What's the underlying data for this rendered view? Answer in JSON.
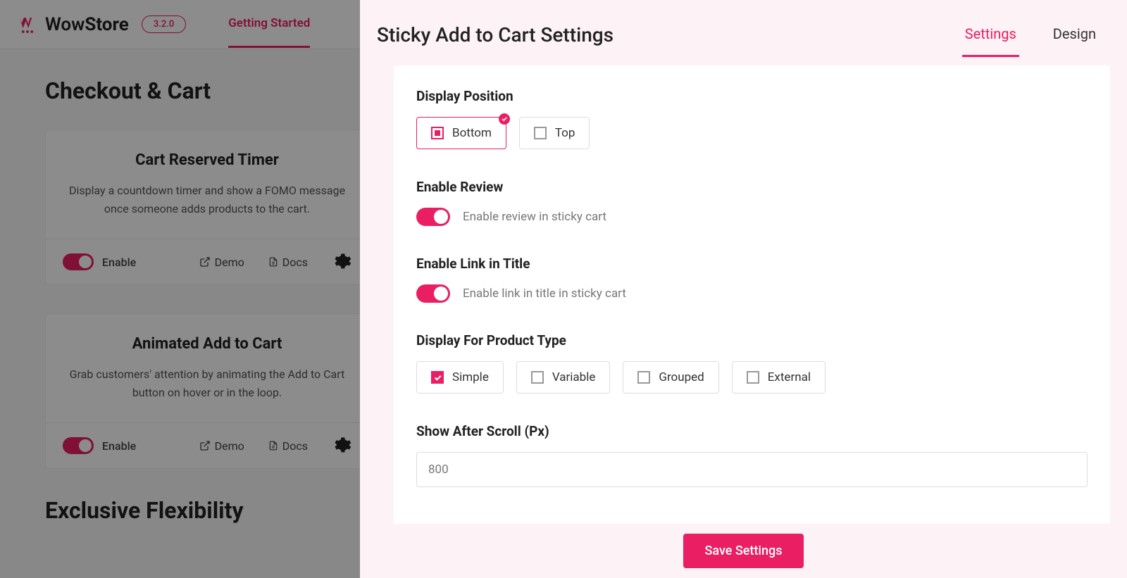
{
  "header": {
    "logo": "WowStore",
    "logo_part1": "Wow",
    "logo_part2": "Store",
    "version": "3.2.0",
    "nav": {
      "getting_started": "Getting Started"
    }
  },
  "page": {
    "section_title": "Checkout & Cart",
    "section2_title": "Exclusive Flexibility",
    "cards": [
      {
        "title": "Cart Reserved Timer",
        "desc": "Display a countdown timer and show a FOMO message once someone adds products to the cart.",
        "enable": "Enable",
        "demo": "Demo",
        "docs": "Docs"
      },
      {
        "title": "Animated Add to Cart",
        "desc": "Grab customers' attention by animating the Add to Cart button on hover or in the loop.",
        "enable": "Enable",
        "demo": "Demo",
        "docs": "Docs"
      }
    ]
  },
  "panel": {
    "title": "Sticky Add to Cart Settings",
    "tabs": {
      "settings": "Settings",
      "design": "Design"
    },
    "settings": {
      "display_position": {
        "label": "Display Position",
        "options": {
          "bottom": "Bottom",
          "top": "Top"
        }
      },
      "enable_review": {
        "label": "Enable Review",
        "desc": "Enable review in sticky cart"
      },
      "enable_link_title": {
        "label": "Enable Link in Title",
        "desc": "Enable link in title in sticky cart"
      },
      "product_type": {
        "label": "Display For Product Type",
        "options": {
          "simple": "Simple",
          "variable": "Variable",
          "grouped": "Grouped",
          "external": "External"
        }
      },
      "scroll": {
        "label": "Show After Scroll (Px)",
        "value": "800"
      }
    },
    "save": "Save Settings"
  }
}
